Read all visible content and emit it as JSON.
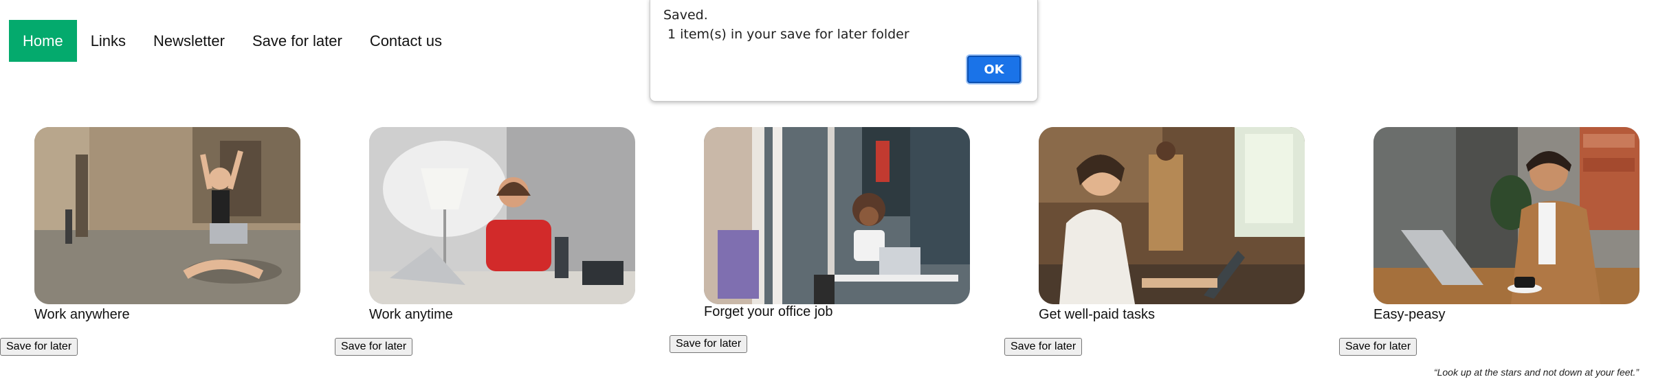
{
  "nav": {
    "items": [
      {
        "label": "Home",
        "active": true
      },
      {
        "label": "Links"
      },
      {
        "label": "Newsletter"
      },
      {
        "label": "Save for later"
      },
      {
        "label": "Contact us"
      }
    ]
  },
  "cards": [
    {
      "caption": "Work anywhere",
      "button": "Save for later"
    },
    {
      "caption": "Work anytime",
      "button": "Save for later"
    },
    {
      "caption": "Forget your office job",
      "button": "Save for later"
    },
    {
      "caption": "Get well-paid tasks",
      "button": "Save for later"
    },
    {
      "caption": "Easy-peasy",
      "button": "Save for later"
    }
  ],
  "quote": "“Look up at the stars and not down at your feet.”",
  "dialog": {
    "title": "Saved.",
    "message": "1 item(s) in your save for later folder",
    "ok_label": "OK"
  },
  "colors": {
    "nav_active_bg": "#04aa6d",
    "dialog_button": "#1a73e8"
  }
}
